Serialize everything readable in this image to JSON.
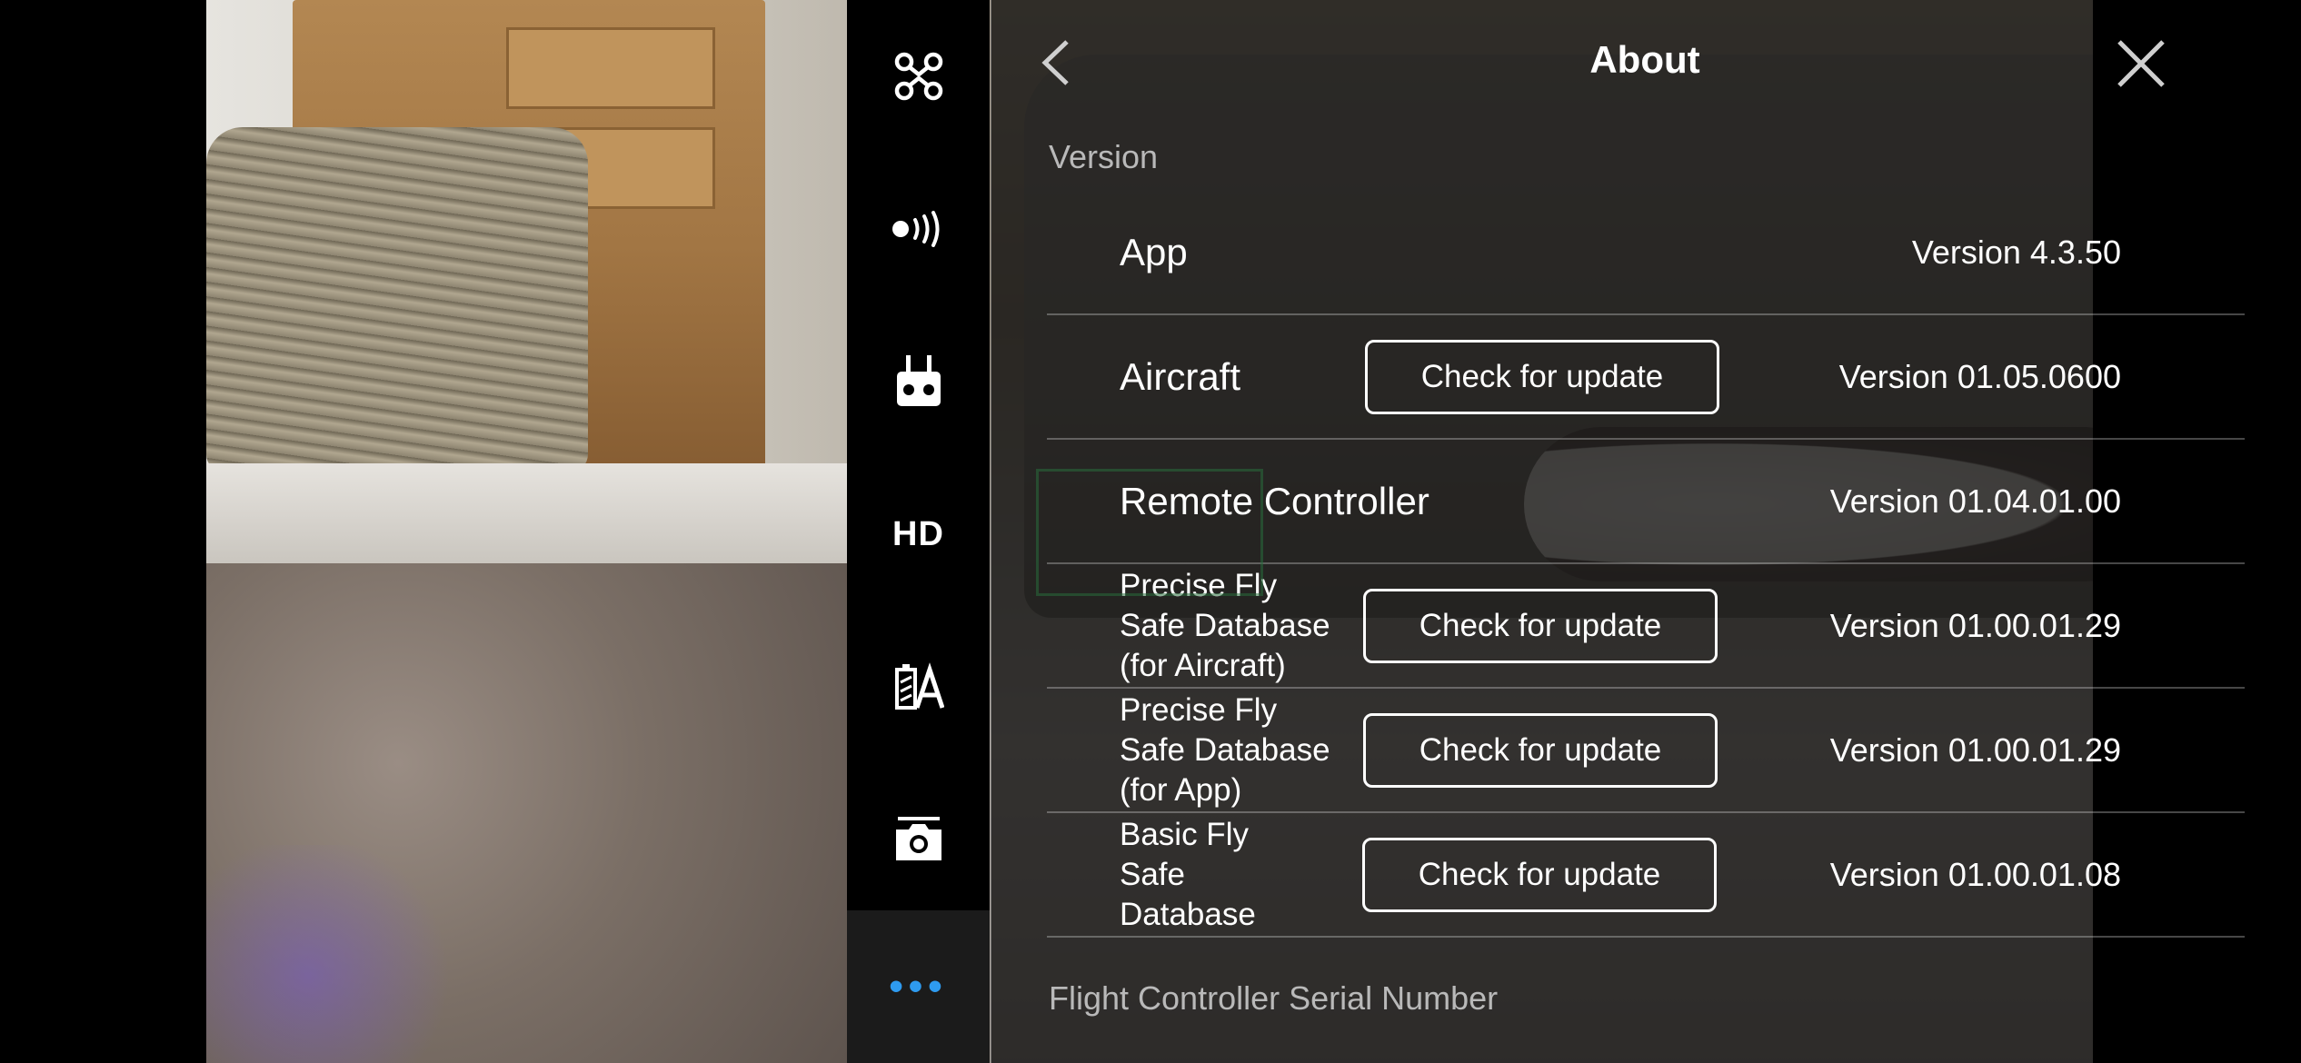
{
  "header": {
    "title": "About"
  },
  "side_nav": {
    "items": [
      {
        "icon": "aircraft-icon"
      },
      {
        "icon": "signal-icon"
      },
      {
        "icon": "remote-controller-icon"
      },
      {
        "label": "HD"
      },
      {
        "icon": "battery-icon"
      },
      {
        "icon": "camera-icon"
      },
      {
        "label": "•••",
        "active": true
      }
    ],
    "accent_color": "#2e9bf0"
  },
  "version_section": {
    "label": "Version",
    "rows": [
      {
        "name": "App",
        "button": "",
        "value": "Version 4.3.50"
      },
      {
        "name": "Aircraft",
        "button": "Check for update",
        "value": "Version 01.05.0600"
      },
      {
        "name": "Remote Controller",
        "button": "",
        "value": "Version 01.04.01.00"
      },
      {
        "name": "Precise Fly\nSafe Database\n(for Aircraft)",
        "button": "Check for update",
        "value": "Version 01.00.01.29"
      },
      {
        "name": "Precise Fly\nSafe Database\n(for App)",
        "button": "Check for update",
        "value": "Version 01.00.01.29"
      },
      {
        "name": "Basic Fly\nSafe\nDatabase",
        "button": "Check for update",
        "value": "Version 01.00.01.08"
      }
    ]
  },
  "serial_section": {
    "label": "Flight Controller Serial Number"
  }
}
